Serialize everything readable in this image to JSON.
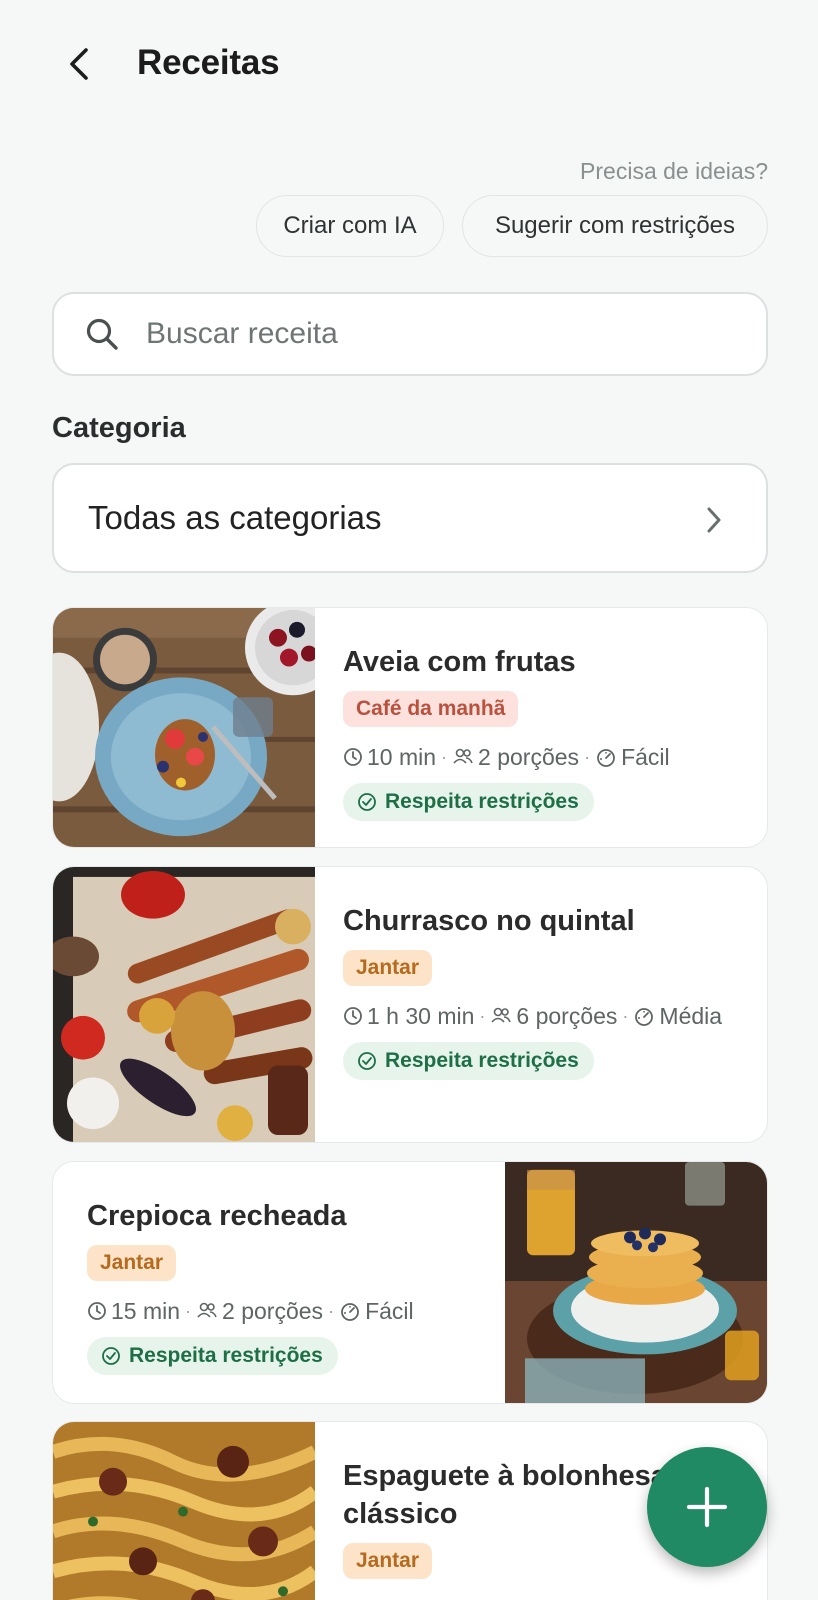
{
  "header": {
    "title": "Receitas"
  },
  "ideas": {
    "prompt": "Precisa de ideias?",
    "create_ai": "Criar com IA",
    "suggest_restrictions": "Sugerir com restrições"
  },
  "search": {
    "placeholder": "Buscar receita",
    "value": ""
  },
  "category": {
    "section_title": "Categoria",
    "selected": "Todas as categorias"
  },
  "recipes": [
    {
      "title": "Aveia com frutas",
      "tag": "Café da manhã",
      "time": "10 min",
      "servings": "2 porções",
      "difficulty": "Fácil",
      "badge": "Respeita restrições"
    },
    {
      "title": "Churrasco no quintal",
      "tag": "Jantar",
      "time": "1 h 30 min",
      "servings": "6 porções",
      "difficulty": "Média",
      "badge": "Respeita restrições"
    },
    {
      "title": "Crepioca recheada",
      "tag": "Jantar",
      "time": "15 min",
      "servings": "2 porções",
      "difficulty": "Fácil",
      "badge": "Respeita restrições"
    },
    {
      "title": "Espaguete à bolonhesa clássico",
      "tag": "Jantar"
    }
  ],
  "icons": {
    "back": "arrow-left-icon",
    "search": "search-icon",
    "chevron": "chevron-right-icon",
    "time": "clock-icon",
    "servings": "people-icon",
    "difficulty": "gauge-icon",
    "badge": "check-circle-icon",
    "fab": "plus-icon"
  },
  "colors": {
    "accent": "#1f8a63",
    "breakfast_tag_bg": "#fde1dc",
    "breakfast_tag_text": "#b9513f",
    "dinner_tag_bg": "#fde4c9",
    "dinner_tag_text": "#b46a1f",
    "badge_bg": "#e6f4ec",
    "badge_text": "#1e6e46"
  }
}
